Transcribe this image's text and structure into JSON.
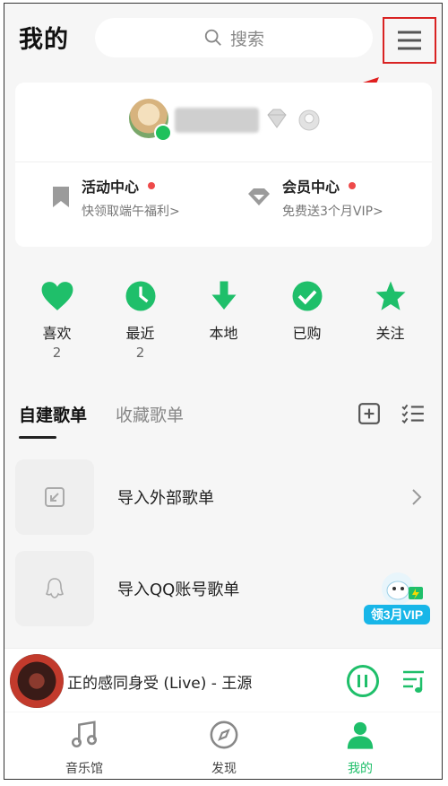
{
  "header": {
    "title": "我的",
    "search_placeholder": "搜索"
  },
  "profile": {
    "promos": [
      {
        "title": "活动中心",
        "subtitle": "快领取端午福利>"
      },
      {
        "title": "会员中心",
        "subtitle": "免费送3个月VIP>"
      }
    ]
  },
  "quick_actions": [
    {
      "label": "喜欢",
      "count": "2"
    },
    {
      "label": "最近",
      "count": "2"
    },
    {
      "label": "本地",
      "count": ""
    },
    {
      "label": "已购",
      "count": ""
    },
    {
      "label": "关注",
      "count": ""
    }
  ],
  "tabs": {
    "self_built": "自建歌单",
    "collected": "收藏歌单"
  },
  "playlists": {
    "import_external": "导入外部歌单",
    "import_qq": "导入QQ账号歌单",
    "vip_badge": "领3月VIP"
  },
  "player": {
    "now_playing": "正的感同身受 (Live) - 王源"
  },
  "bottom_nav": {
    "music_hall": "音乐馆",
    "discover": "发现",
    "mine": "我的"
  },
  "colors": {
    "accent": "#1fbf6a",
    "highlight_box": "#d92323",
    "notification_dot": "#ee4a4a"
  }
}
